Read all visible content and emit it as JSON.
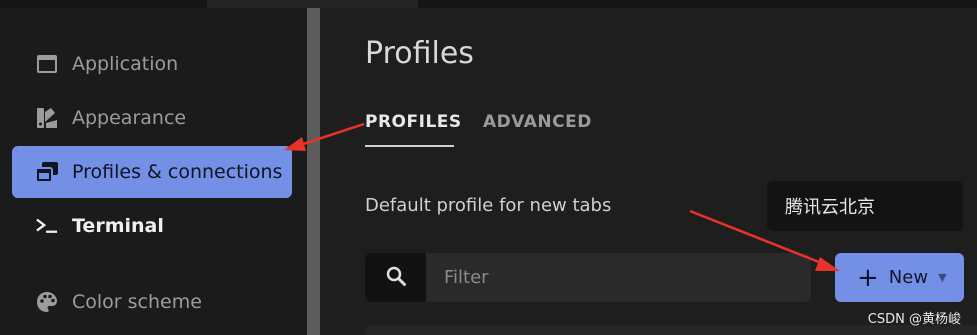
{
  "sidebar": {
    "items": [
      {
        "label": "Application",
        "icon": "window-icon"
      },
      {
        "label": "Appearance",
        "icon": "palette-brush-icon"
      },
      {
        "label": "Profiles & connections",
        "icon": "windows-stack-icon",
        "active": true
      },
      {
        "label": "Terminal",
        "icon": "terminal-prompt-icon"
      },
      {
        "label": "Color scheme",
        "icon": "color-palette-icon"
      }
    ]
  },
  "main": {
    "title": "Profiles",
    "tabs": [
      {
        "label": "PROFILES",
        "active": true
      },
      {
        "label": "ADVANCED"
      }
    ],
    "default_profile_label": "Default profile for new tabs",
    "default_profile_value": "腾讯云北京",
    "filter_placeholder": "Filter",
    "new_button_label": "New"
  },
  "watermark": "CSDN @黄杨峻",
  "colors": {
    "accent": "#7390e6",
    "annotation_arrow": "#e8332a"
  }
}
